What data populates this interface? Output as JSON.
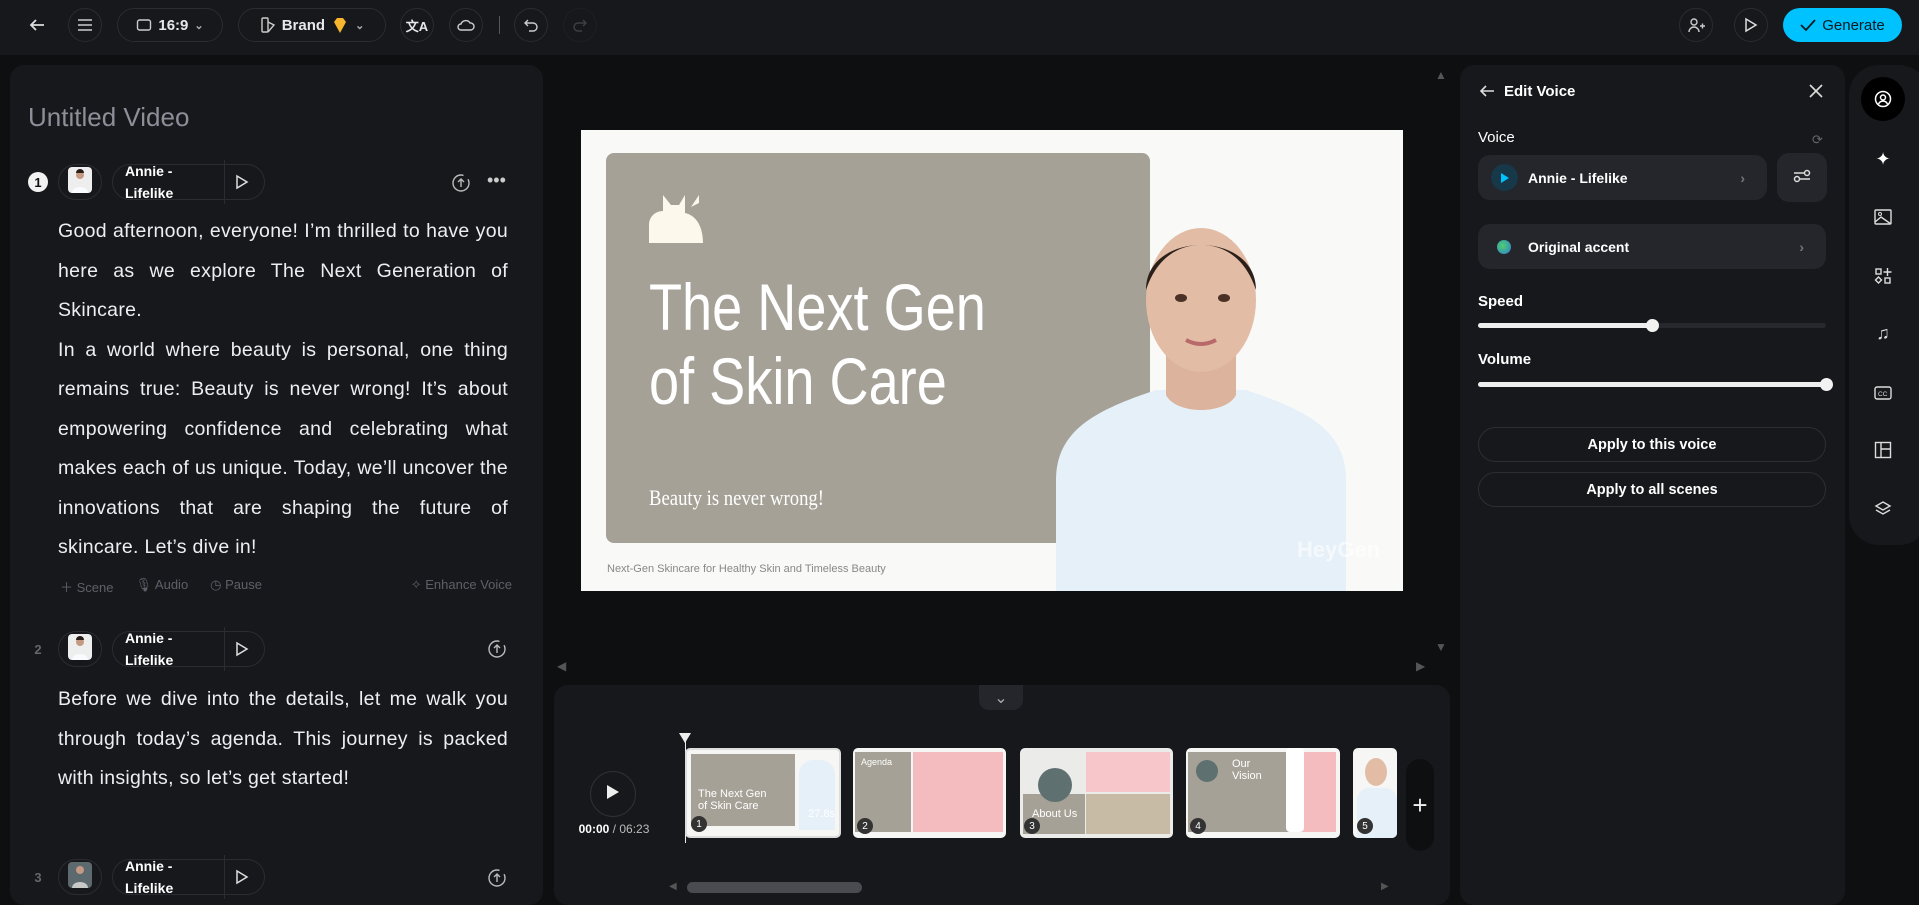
{
  "toolbar": {
    "aspect": "16:9",
    "brand": "Brand",
    "generate": "Generate"
  },
  "project": {
    "title": "Untitled Video"
  },
  "scenes": [
    {
      "number": "1",
      "voice": "Annie - Lifelike",
      "text": "Good afternoon, everyone! I’m thrilled to have you here as we explore The Next Generation of Skincare.\nIn a world where beauty is personal, one thing remains true: Beauty is never wrong! It’s about empowering confidence and celebrating what makes each of us unique. Today, we’ll uncover the innovations that are shaping the future of skincare. Let’s dive in!"
    },
    {
      "number": "2",
      "voice": "Annie - Lifelike",
      "text": "Before we dive into the details, let me walk you through today’s agenda. This journey is packed with insights, so let’s get started!"
    },
    {
      "number": "3",
      "voice": "Annie - Lifelike"
    }
  ],
  "scene_actions": {
    "scene": "Scene",
    "audio": "Audio",
    "pause": "Pause",
    "enhance": "Enhance Voice"
  },
  "slide": {
    "title_line1": "The Next Gen",
    "title_line2": "of Skin Care",
    "subtitle": "Beauty is never wrong!",
    "footer": "Next-Gen Skincare for Healthy Skin and Timeless Beauty",
    "watermark": "HeyGen"
  },
  "timeline": {
    "current": "00:00",
    "total": "06:23",
    "thumbs": [
      {
        "number": "1",
        "label": "The Next Gen of Skin Care",
        "duration": "27.8s"
      },
      {
        "number": "2",
        "label": "Agenda"
      },
      {
        "number": "3",
        "label": "About Us"
      },
      {
        "number": "4",
        "label": "Our Vision"
      },
      {
        "number": "5"
      }
    ]
  },
  "edit_voice": {
    "title": "Edit Voice",
    "voice_label": "Voice",
    "voice_name": "Annie - Lifelike",
    "accent": "Original accent",
    "speed_label": "Speed",
    "speed_value": 0.5,
    "volume_label": "Volume",
    "volume_value": 1.0,
    "apply_voice": "Apply to this voice",
    "apply_all": "Apply to all scenes"
  },
  "colors": {
    "accent": "#00c2ff",
    "panel": "#17181c",
    "slide_box": "#a5a197"
  }
}
